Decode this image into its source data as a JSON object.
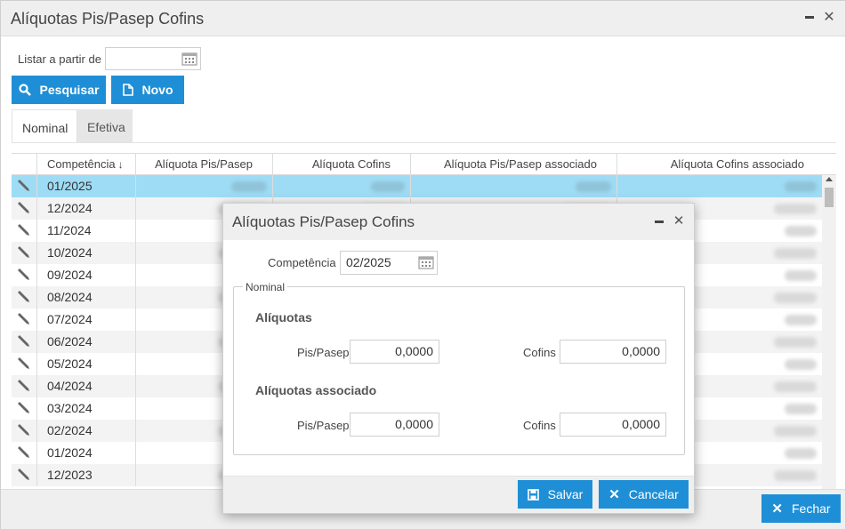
{
  "window": {
    "title": "Alíquotas Pis/Pasep Cofins"
  },
  "filter": {
    "label": "Listar a partir de",
    "date_value": ""
  },
  "toolbar": {
    "search_label": "Pesquisar",
    "new_label": "Novo"
  },
  "tabs": [
    {
      "label": "Nominal",
      "active": true
    },
    {
      "label": "Efetiva",
      "active": false
    }
  ],
  "grid": {
    "columns": [
      "Competência",
      "Alíquota Pis/Pasep",
      "Alíquota Cofins",
      "Alíquota Pis/Pasep associado",
      "Alíquota Cofins associado"
    ],
    "sort_icon": "sort-down-arrow",
    "rows": [
      {
        "competencia": "01/2025"
      },
      {
        "competencia": "12/2024"
      },
      {
        "competencia": "11/2024"
      },
      {
        "competencia": "10/2024"
      },
      {
        "competencia": "09/2024"
      },
      {
        "competencia": "08/2024"
      },
      {
        "competencia": "07/2024"
      },
      {
        "competencia": "06/2024"
      },
      {
        "competencia": "05/2024"
      },
      {
        "competencia": "04/2024"
      },
      {
        "competencia": "03/2024"
      },
      {
        "competencia": "02/2024"
      },
      {
        "competencia": "01/2024"
      },
      {
        "competencia": "12/2023"
      }
    ],
    "selected_row": 0
  },
  "footer": {
    "close_label": "Fechar"
  },
  "dialog": {
    "title": "Alíquotas Pis/Pasep Cofins",
    "competencia_label": "Competência",
    "competencia_value": "02/2025",
    "fieldset_legend": "Nominal",
    "aliquotas_title": "Alíquotas",
    "aliquotas_assoc_title": "Alíquotas associado",
    "pis_label": "Pis/Pasep",
    "cofins_label": "Cofins",
    "pis_value": "0,0000",
    "cofins_value": "0,0000",
    "pis_assoc_value": "0,0000",
    "cofins_assoc_value": "0,0000",
    "save_label": "Salvar",
    "cancel_label": "Cancelar"
  },
  "colors": {
    "accent": "#1e8fd6",
    "selected_row": "#9edcf5",
    "title_bar": "#efefef"
  }
}
